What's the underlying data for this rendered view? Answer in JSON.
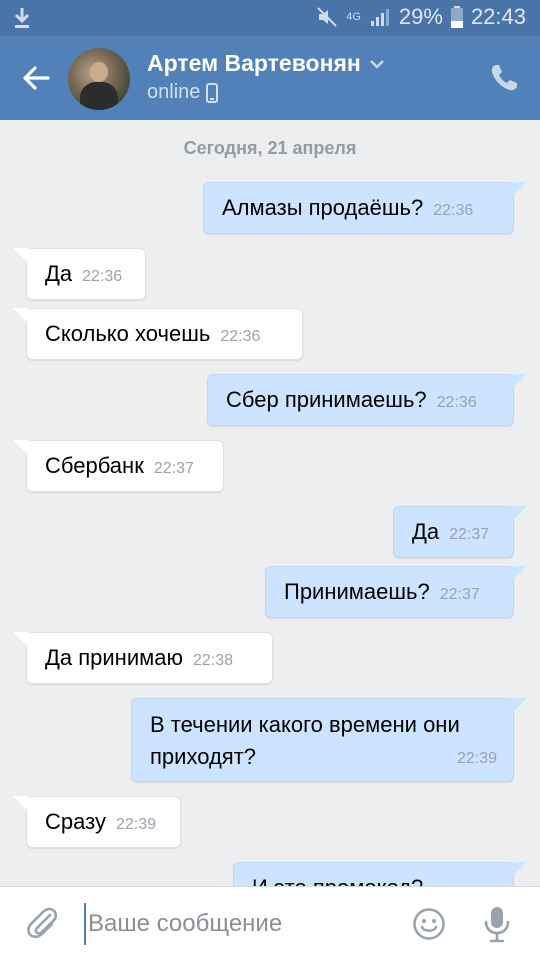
{
  "status_bar": {
    "battery": "29%",
    "time": "22:43",
    "network": "4G",
    "icons": [
      "download-icon",
      "mute-icon",
      "signal-icon",
      "battery-icon"
    ]
  },
  "header": {
    "contact_name": "Артем Вартевонян",
    "status": "online",
    "icons": [
      "back-arrow-icon",
      "chevron-down-icon",
      "mobile-icon",
      "phone-icon"
    ]
  },
  "chat": {
    "date_separator": "Сегодня, 21 апреля",
    "messages": [
      {
        "dir": "out",
        "text": "Алмазы продаёшь?",
        "time": "22:36"
      },
      {
        "dir": "in",
        "text": "Да",
        "time": "22:36"
      },
      {
        "dir": "in",
        "text": "Сколько хочешь",
        "time": "22:36"
      },
      {
        "dir": "out",
        "text": "Сбер принимаешь?",
        "time": "22:36"
      },
      {
        "dir": "in",
        "text": "Сбербанк",
        "time": "22:37"
      },
      {
        "dir": "out",
        "text": "Да",
        "time": "22:37"
      },
      {
        "dir": "out",
        "text": "Принимаешь?",
        "time": "22:37"
      },
      {
        "dir": "in",
        "text": "Да принимаю",
        "time": "22:38"
      },
      {
        "dir": "out",
        "text": "В течении какого времени они приходят?",
        "time": "22:39"
      },
      {
        "dir": "in",
        "text": "Сразу",
        "time": "22:39"
      },
      {
        "dir": "out",
        "text": "И это промокод?",
        "time": ""
      }
    ]
  },
  "composer": {
    "placeholder": "Ваше сообщение",
    "icons": [
      "paperclip-icon",
      "emoji-icon",
      "microphone-icon"
    ]
  },
  "colors": {
    "status_bar": "#4a73a8",
    "header": "#5181b8",
    "background": "#edeef0",
    "outgoing_bubble": "#cce4ff",
    "incoming_bubble": "#ffffff"
  }
}
